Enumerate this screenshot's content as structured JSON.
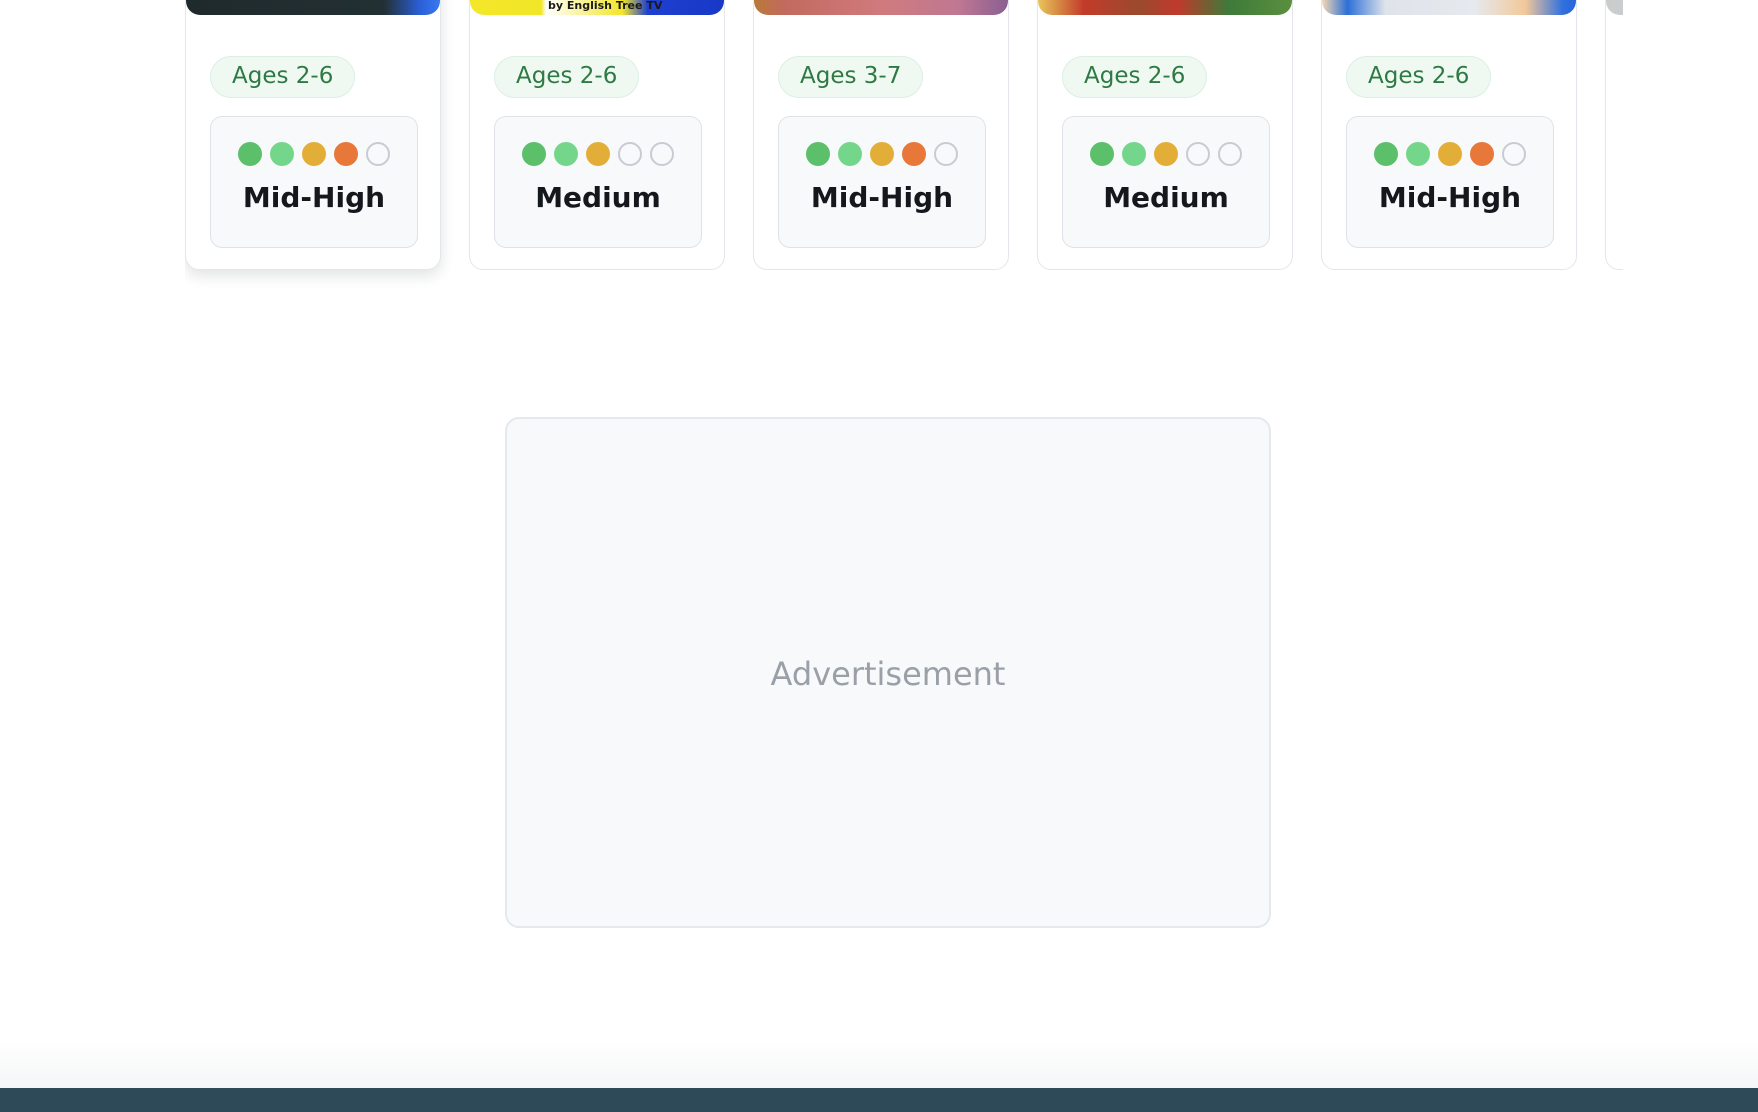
{
  "cards": [
    {
      "age": "Ages 2-6",
      "level": "Mid-High",
      "dots": 4,
      "caption": ""
    },
    {
      "age": "Ages 2-6",
      "level": "Medium",
      "dots": 3,
      "caption": "by English Tree TV"
    },
    {
      "age": "Ages 3-7",
      "level": "Mid-High",
      "dots": 4,
      "caption": ""
    },
    {
      "age": "Ages 2-6",
      "level": "Medium",
      "dots": 3,
      "caption": ""
    },
    {
      "age": "Ages 2-6",
      "level": "Mid-High",
      "dots": 4,
      "caption": ""
    }
  ],
  "level_scale_max": 5,
  "level_dot_colors": [
    "#5cbf6a",
    "#73d68a",
    "#e3ae37",
    "#e8783a"
  ],
  "ad": {
    "label": "Advertisement"
  },
  "colors": {
    "age_badge_text": "#2f7a44",
    "age_badge_bg": "#eff9f2",
    "footer": "#2e4a58"
  }
}
